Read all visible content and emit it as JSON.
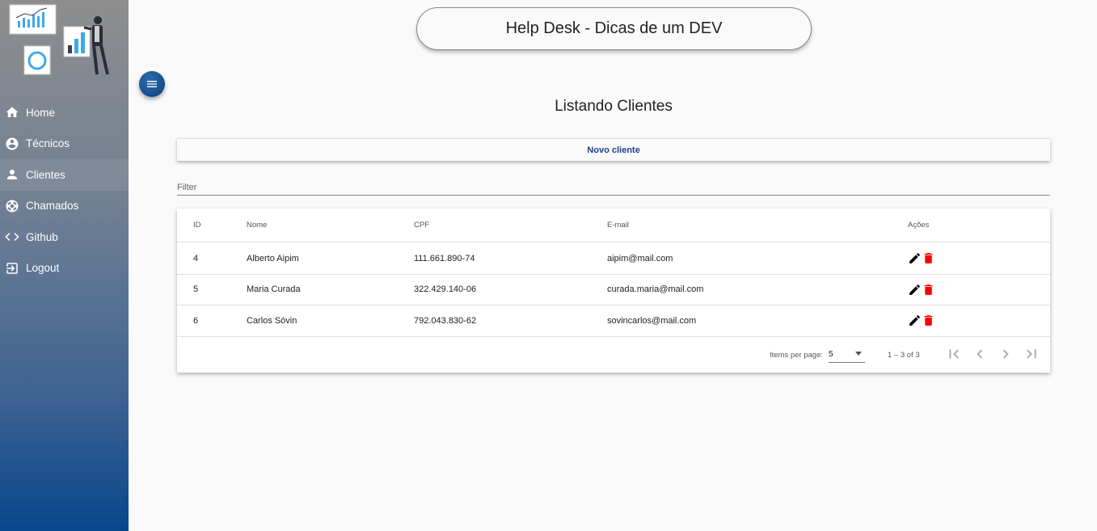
{
  "header": {
    "title": "Help Desk - Dicas de um DEV"
  },
  "sidebar": {
    "items": [
      {
        "label": "Home",
        "icon": "home-icon"
      },
      {
        "label": "Técnicos",
        "icon": "account-circle-icon"
      },
      {
        "label": "Clientes",
        "icon": "person-icon"
      },
      {
        "label": "Chamados",
        "icon": "support-icon"
      },
      {
        "label": "Github",
        "icon": "code-icon"
      },
      {
        "label": "Logout",
        "icon": "logout-icon"
      }
    ]
  },
  "main": {
    "title": "Listando Clientes",
    "new_button": "Novo cliente",
    "filter_placeholder": "Filter",
    "table": {
      "headers": [
        "ID",
        "Nome",
        "CPF",
        "E-mail",
        "Ações"
      ],
      "rows": [
        {
          "id": "4",
          "nome": "Alberto Aipim",
          "cpf": "111.661.890-74",
          "email": "aipim@mail.com"
        },
        {
          "id": "5",
          "nome": "Maria Curada",
          "cpf": "322.429.140-06",
          "email": "curada.maria@mail.com"
        },
        {
          "id": "6",
          "nome": "Carlos Sóvin",
          "cpf": "792.043.830-62",
          "email": "sovincarlos@mail.com"
        }
      ]
    },
    "paginator": {
      "items_per_page_label": "Items per page:",
      "page_size": "5",
      "range": "1 – 3 of 3"
    }
  },
  "colors": {
    "accent": "#1e3c8c",
    "delete": "#ff0000",
    "sidebar_bottom": "#07468c"
  }
}
